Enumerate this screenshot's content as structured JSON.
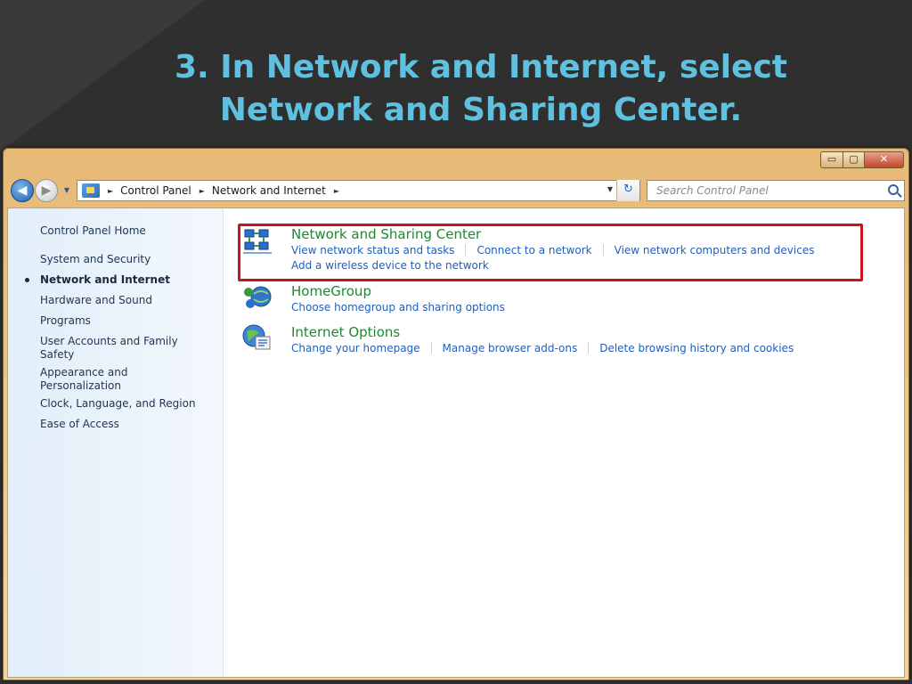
{
  "slide": {
    "title_line1": "3. In Network and Internet, select",
    "title_line2": "Network and Sharing Center."
  },
  "window": {
    "controls": {
      "minimize": "▭",
      "maximize": "▢",
      "close": "✕"
    }
  },
  "navbar": {
    "back_icon": "arrow-left-icon",
    "forward_icon": "arrow-right-icon",
    "back_glyph": "◀",
    "forward_glyph": "▶",
    "recent_glyph": "▼",
    "breadcrumbs": [
      "Control Panel",
      "Network and Internet"
    ],
    "crumb_separator": "►",
    "refresh_glyph": "↻",
    "dropdown_glyph": "▼",
    "search_placeholder": "Search Control Panel"
  },
  "sidebar": {
    "home": "Control Panel Home",
    "items": [
      {
        "label": "System and Security"
      },
      {
        "label": "Network and Internet",
        "active": true
      },
      {
        "label": "Hardware and Sound"
      },
      {
        "label": "Programs"
      },
      {
        "label": "User Accounts and Family Safety"
      },
      {
        "label": "Appearance and Personalization"
      },
      {
        "label": "Clock, Language, and Region"
      },
      {
        "label": "Ease of Access"
      }
    ]
  },
  "categories": [
    {
      "title": "Network and Sharing Center",
      "icon": "network-sharing-icon",
      "links": [
        [
          "View network status and tasks",
          "Connect to a network",
          "View network computers and devices"
        ],
        [
          "Add a wireless device to the network"
        ]
      ]
    },
    {
      "title": "HomeGroup",
      "icon": "homegroup-icon",
      "links": [
        [
          "Choose homegroup and sharing options"
        ]
      ]
    },
    {
      "title": "Internet Options",
      "icon": "internet-options-icon",
      "links": [
        [
          "Change your homepage",
          "Manage browser add-ons",
          "Delete browsing history and cookies"
        ]
      ]
    }
  ],
  "colors": {
    "title_text": "#5fc0df",
    "highlight_border": "#c4161c",
    "category_title": "#1b8a2e",
    "link": "#1f5fbd"
  }
}
